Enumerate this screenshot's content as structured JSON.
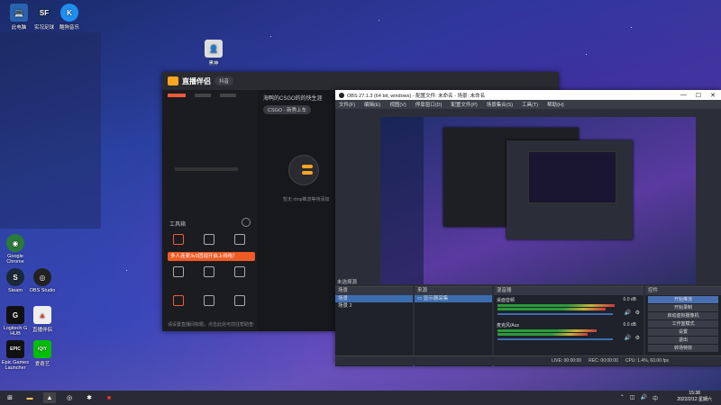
{
  "desktop": {
    "icons": [
      {
        "label": "此电脑",
        "glyph": "💻",
        "bg": "#2a63b0"
      },
      {
        "label": "实况足球",
        "glyph": "SF",
        "bg": "#1a2e6a"
      },
      {
        "label": "酷狗音乐",
        "glyph": "K",
        "bg": "#1e8ef0"
      },
      {
        "label": "Google Chrome",
        "glyph": "◉",
        "bg": "#2a7a3a"
      },
      {
        "label": "Steam",
        "glyph": "S",
        "bg": "#1b2838"
      },
      {
        "label": "OBS Studio",
        "glyph": "◎",
        "bg": "#222"
      },
      {
        "label": "Logitech G HUB",
        "glyph": "G",
        "bg": "#111"
      },
      {
        "label": "直播伴侣",
        "glyph": "▲",
        "bg": "#eee"
      },
      {
        "label": "Epic Games Launcher",
        "glyph": "EPIC",
        "bg": "#111"
      },
      {
        "label": "爱奇艺",
        "glyph": "iQIY",
        "bg": "#00be06"
      },
      {
        "label": "黑神",
        "glyph": "👤",
        "bg": "#ddd"
      }
    ]
  },
  "zb": {
    "title": "直播伴侣",
    "badge": "抖音",
    "room_title": "海鸭的CSGO的的快生涯",
    "scene_tag": "CSGO - 新秀上车",
    "tools_label": "工具箱",
    "banner": "多人连麦3v3团战开启上线啦！",
    "empty_text": "暂无 rtmp推流等待添加",
    "bottom_text": "请设置直播间标题，点击此处可前往帮助查看"
  },
  "obs": {
    "title": "OBS 27.1.3 (64 bit, windows) - 配置文件: 未命名 - 场景: 未命名",
    "menu": [
      "文件(F)",
      "编辑(E)",
      "视图(V)",
      "停靠窗口(D)",
      "配置文件(P)",
      "场景集合(S)",
      "工具(T)",
      "帮助(H)"
    ],
    "preview_label": "未选择源",
    "scenes_header": "场景",
    "scenes": [
      "场景",
      "场景 2"
    ],
    "sources_header": "来源",
    "sources": [
      "显示器采集"
    ],
    "mixer_header": "混音器",
    "mixer": [
      {
        "name": "桌面音频",
        "db": "0.0 dB",
        "level": 0.86
      },
      {
        "name": "麦克风/Aux",
        "db": "0.0 dB",
        "level": 0.74
      }
    ],
    "controls_header": "控件",
    "controls": [
      "开始推流",
      "开始录制",
      "启动虚拟摄像机",
      "工作室模式",
      "设置",
      "退出"
    ],
    "transition_label": "转场特效",
    "status": [
      "LIVE: 00:00:00",
      "REC: 00:00:00",
      "CPU: 1.4%, 60.00 fps"
    ]
  },
  "taskbar": {
    "time": "15:38",
    "date": "2022/2/12 星期六"
  }
}
